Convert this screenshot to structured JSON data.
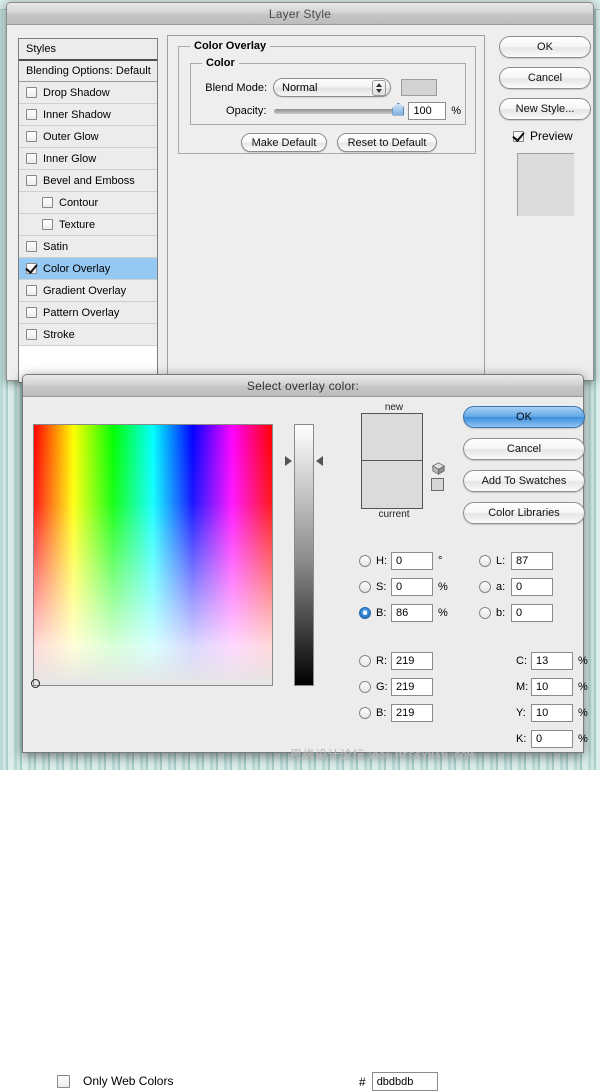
{
  "desktop": {
    "background_color": "#c6e0dc"
  },
  "layer_style_dialog": {
    "title": "Layer Style",
    "styles_panel": {
      "header": "Styles",
      "blending_options": "Blending Options: Default",
      "items": [
        {
          "label": "Drop Shadow",
          "checked": false,
          "indent": false,
          "selected": false
        },
        {
          "label": "Inner Shadow",
          "checked": false,
          "indent": false,
          "selected": false
        },
        {
          "label": "Outer Glow",
          "checked": false,
          "indent": false,
          "selected": false
        },
        {
          "label": "Inner Glow",
          "checked": false,
          "indent": false,
          "selected": false
        },
        {
          "label": "Bevel and Emboss",
          "checked": false,
          "indent": false,
          "selected": false
        },
        {
          "label": "Contour",
          "checked": false,
          "indent": true,
          "selected": false
        },
        {
          "label": "Texture",
          "checked": false,
          "indent": true,
          "selected": false
        },
        {
          "label": "Satin",
          "checked": false,
          "indent": false,
          "selected": false
        },
        {
          "label": "Color Overlay",
          "checked": true,
          "indent": false,
          "selected": true
        },
        {
          "label": "Gradient Overlay",
          "checked": false,
          "indent": false,
          "selected": false
        },
        {
          "label": "Pattern Overlay",
          "checked": false,
          "indent": false,
          "selected": false
        },
        {
          "label": "Stroke",
          "checked": false,
          "indent": false,
          "selected": false
        }
      ]
    },
    "overlay_panel": {
      "group_title": "Color Overlay",
      "subgroup_title": "Color",
      "blend_mode_label": "Blend Mode:",
      "blend_mode_value": "Normal",
      "overlay_color": "#d3d3d3",
      "opacity_label": "Opacity:",
      "opacity_value": "100",
      "opacity_unit": "%",
      "make_default": "Make Default",
      "reset_to_default": "Reset to Default"
    },
    "buttons": {
      "ok": "OK",
      "cancel": "Cancel",
      "new_style": "New Style...",
      "preview_label": "Preview",
      "preview_checked": true,
      "preview_swatch_color": "#dcdcdc"
    }
  },
  "color_picker": {
    "title": "Select overlay color:",
    "preview": {
      "new_label": "new",
      "current_label": "current",
      "new_color": "#dbdbdb",
      "current_color": "#dbdbdb"
    },
    "buttons": {
      "ok": "OK",
      "cancel": "Cancel",
      "add_to_swatches": "Add To Swatches",
      "color_libraries": "Color Libraries"
    },
    "hsb": [
      {
        "key": "H:",
        "value": "0",
        "unit": "°",
        "selected": false
      },
      {
        "key": "S:",
        "value": "0",
        "unit": "%",
        "selected": false
      },
      {
        "key": "B:",
        "value": "86",
        "unit": "%",
        "selected": true
      }
    ],
    "lab": [
      {
        "key": "L:",
        "value": "87",
        "unit": "",
        "selected": false
      },
      {
        "key": "a:",
        "value": "0",
        "unit": "",
        "selected": false
      },
      {
        "key": "b:",
        "value": "0",
        "unit": "",
        "selected": false
      }
    ],
    "rgb": [
      {
        "key": "R:",
        "value": "219",
        "unit": "",
        "selected": false
      },
      {
        "key": "G:",
        "value": "219",
        "unit": "",
        "selected": false
      },
      {
        "key": "B:",
        "value": "219",
        "unit": "",
        "selected": false
      }
    ],
    "cmyk": [
      {
        "key": "C:",
        "value": "13",
        "unit": "%"
      },
      {
        "key": "M:",
        "value": "10",
        "unit": "%"
      },
      {
        "key": "Y:",
        "value": "10",
        "unit": "%"
      },
      {
        "key": "K:",
        "value": "0",
        "unit": "%"
      }
    ],
    "hex_label": "#",
    "hex_value": "dbdbdb",
    "only_web_colors_label": "Only Web Colors",
    "only_web_colors_checked": false
  },
  "watermark": {
    "text": "思缘设计论坛",
    "site": "WWW.MISSYUAN.COM"
  }
}
